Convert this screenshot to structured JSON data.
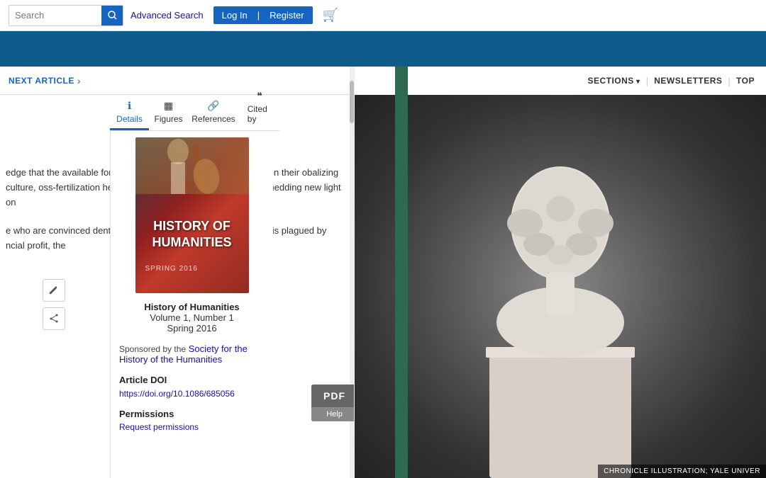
{
  "header": {
    "search_placeholder": "Search",
    "advanced_search": "Advanced Search",
    "login_label": "Log In",
    "divider": "|",
    "register_label": "Register"
  },
  "tabs": [
    {
      "id": "details",
      "label": "Details",
      "icon": "ℹ",
      "active": true
    },
    {
      "id": "figures",
      "label": "Figures",
      "icon": "🖼"
    },
    {
      "id": "references",
      "label": "References",
      "icon": "🔗"
    },
    {
      "id": "cited-by",
      "label": "Cited by",
      "icon": "❝"
    }
  ],
  "next_article": {
    "label": "NEXT ARTICLE",
    "arrow": "›"
  },
  "journal": {
    "cover_title_line1": "HISTORY OF",
    "cover_title_line2": "HUMANITIES",
    "cover_season": "SPRING 2016",
    "meta_title": "History of Humanities",
    "meta_volume": "Volume 1, Number 1",
    "meta_season": "Spring 2016",
    "sponsored_prefix": "Sponsored by the",
    "sponsored_link_text": "Society for the History of the Humanities",
    "article_doi_label": "Article DOI",
    "doi_url": "https://doi.org/10.1086/685056",
    "permissions_label": "Permissions",
    "permissions_link": "Request permissions"
  },
  "article_text": {
    "para1": "edge that the available for the benefit s digital tools enable nd even their obalizing culture, oss-fertilization he complex chemical able to both artists hedding new light on",
    "para2": "e who are convinced dents taking orldwide are subject to e world is plagued by ncial profit, the"
  },
  "pdf_btn": {
    "label": "PDF",
    "help": "Help"
  },
  "chronicle": {
    "nav_sections": "SECTIONS",
    "nav_newsletters": "NEWSLETTERS",
    "nav_top": "TOP",
    "caption": "CHRONICLE ILLUSTRATION; YALE UNIVER"
  }
}
